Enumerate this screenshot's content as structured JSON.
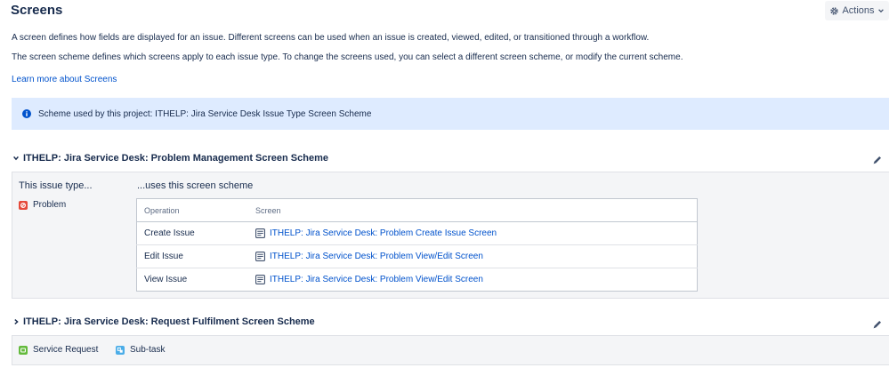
{
  "page": {
    "title": "Screens",
    "actions_label": "Actions",
    "description_1": "A screen defines how fields are displayed for an issue. Different screens can be used when an issue is created, viewed, edited, or transitioned through a workflow.",
    "description_2": "The screen scheme defines which screens apply to each issue type. To change the screens used, you can select a different screen scheme, or modify the current scheme.",
    "learn_more": "Learn more about Screens"
  },
  "banner": {
    "text": "Scheme used by this project: ITHELP: Jira Service Desk Issue Type Screen Scheme"
  },
  "schemes": [
    {
      "title": "ITHELP: Jira Service Desk: Problem Management Screen Scheme",
      "expanded": true,
      "issue_type_heading": "This issue type...",
      "scheme_heading": "...uses this screen scheme",
      "issue_types": [
        {
          "label": "Problem",
          "icon": "problem-icon",
          "color": "#e5493a"
        }
      ],
      "table": {
        "headers": [
          "Operation",
          "Screen"
        ],
        "rows": [
          {
            "operation": "Create Issue",
            "screen": "ITHELP: Jira Service Desk: Problem Create Issue Screen"
          },
          {
            "operation": "Edit Issue",
            "screen": "ITHELP: Jira Service Desk: Problem View/Edit Screen"
          },
          {
            "operation": "View Issue",
            "screen": "ITHELP: Jira Service Desk: Problem View/Edit Screen"
          }
        ]
      }
    },
    {
      "title": "ITHELP: Jira Service Desk: Request Fulfilment Screen Scheme",
      "expanded": false,
      "issue_types": [
        {
          "label": "Service Request",
          "icon": "service-request-icon",
          "color": "#63ba3c"
        },
        {
          "label": "Sub-task",
          "icon": "subtask-icon",
          "color": "#4bade8"
        }
      ]
    }
  ],
  "colors": {
    "link": "#0052cc",
    "banner_bg": "#deebff",
    "panel_bg": "#f4f5f7",
    "text": "#172b4d"
  }
}
